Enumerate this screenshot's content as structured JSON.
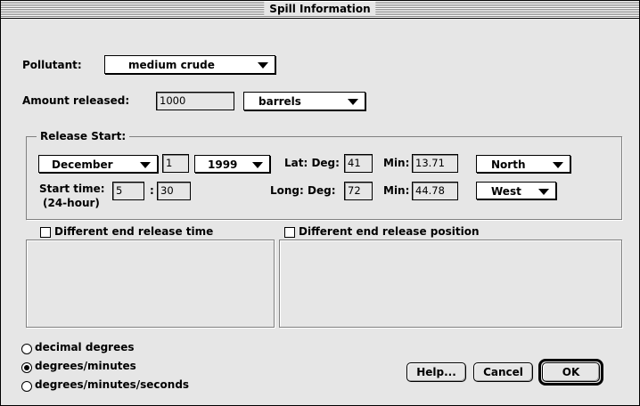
{
  "window": {
    "title": "Spill Information"
  },
  "pollutant": {
    "label": "Pollutant:",
    "value": "medium crude"
  },
  "amount": {
    "label": "Amount released:",
    "value": "1000",
    "unit": "barrels"
  },
  "release_start": {
    "group_title": "Release Start:",
    "month": "December",
    "day": "1",
    "year": "1999",
    "start_time_label": "Start time:",
    "start_time_sub": "(24-hour)",
    "hour": "5",
    "time_sep": ":",
    "minute": "30",
    "lat_label": "Lat: Deg:",
    "lat_deg": "41",
    "lat_min_label": "Min:",
    "lat_min": "13.71",
    "lat_dir": "North",
    "long_label": "Long: Deg:",
    "long_deg": "72",
    "long_min_label": "Min:",
    "long_min": "44.78",
    "long_dir": "West"
  },
  "end_time_checkbox": {
    "label": "Different end release time",
    "checked": false
  },
  "end_position_checkbox": {
    "label": "Different end release position",
    "checked": false
  },
  "format_options": [
    {
      "label": "decimal degrees",
      "selected": false
    },
    {
      "label": "degrees/minutes",
      "selected": true
    },
    {
      "label": "degrees/minutes/seconds",
      "selected": false
    }
  ],
  "buttons": {
    "help": "Help...",
    "cancel": "Cancel",
    "ok": "OK"
  }
}
